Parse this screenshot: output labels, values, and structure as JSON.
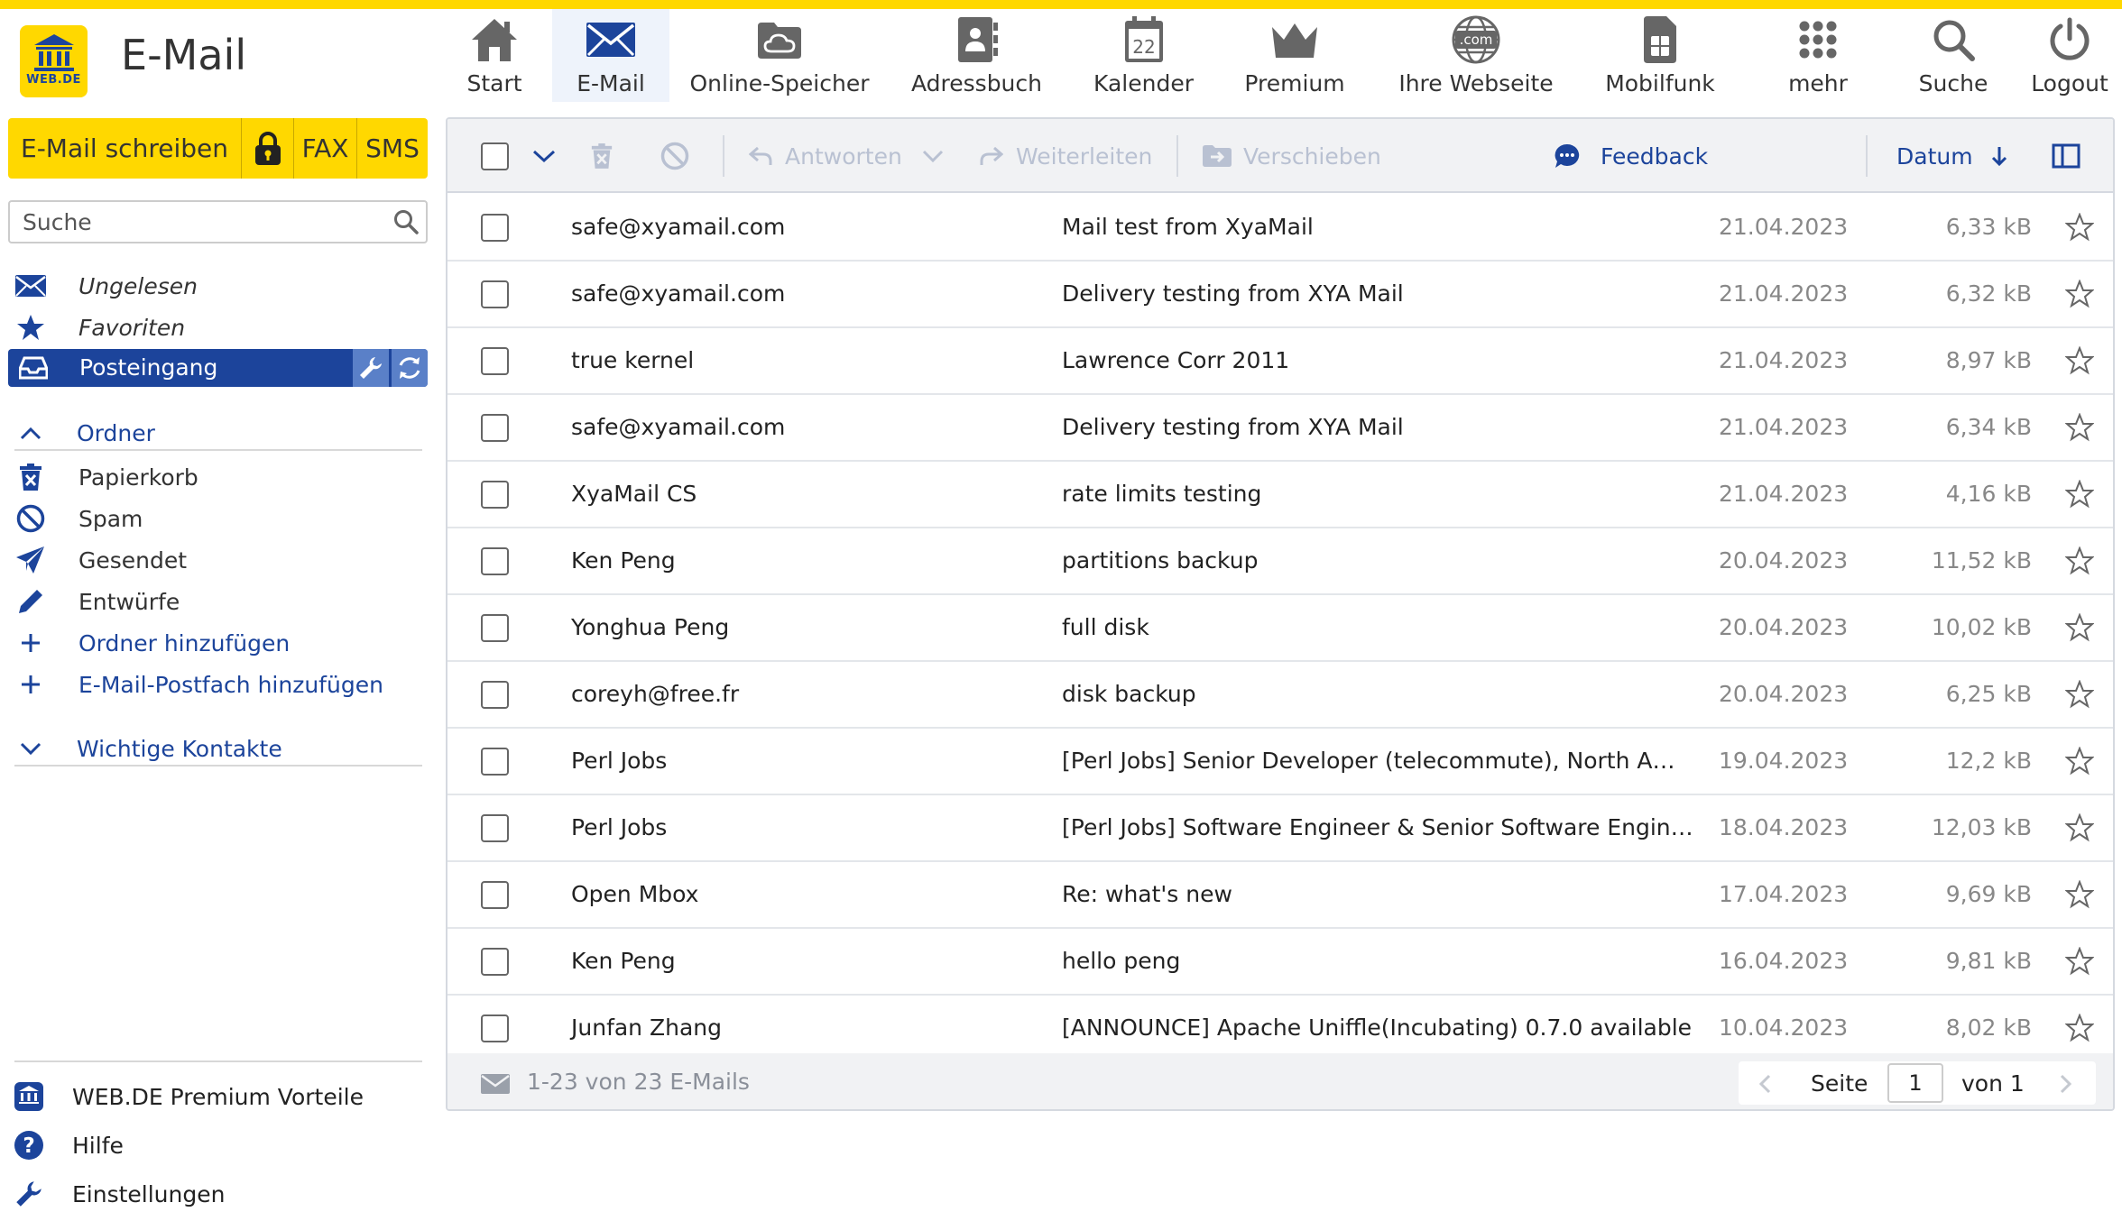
{
  "app": {
    "title": "E-Mail",
    "logo_text": "WEB.DE"
  },
  "nav": [
    {
      "label": "Start",
      "icon": "house-icon"
    },
    {
      "label": "E-Mail",
      "icon": "envelope-icon"
    },
    {
      "label": "Online-Speicher",
      "icon": "cloud-icon"
    },
    {
      "label": "Adressbuch",
      "icon": "addressbook-icon"
    },
    {
      "label": "Kalender",
      "icon": "calendar-icon",
      "badge": "22"
    },
    {
      "label": "Premium",
      "icon": "crown-icon"
    },
    {
      "label": "Ihre Webseite",
      "icon": "globe-icon",
      "badge": ".com"
    },
    {
      "label": "Mobilfunk",
      "icon": "sim-icon"
    },
    {
      "label": "mehr",
      "icon": "grid-icon"
    },
    {
      "label": "Suche",
      "icon": "search-icon"
    },
    {
      "label": "Logout",
      "icon": "power-icon"
    }
  ],
  "compose": {
    "write": "E-Mail schreiben",
    "fax": "FAX",
    "sms": "SMS"
  },
  "search": {
    "placeholder": "Suche"
  },
  "sidebar": {
    "unread": "Ungelesen",
    "favorites": "Favoriten",
    "inbox": "Posteingang",
    "folders_header": "Ordner",
    "trash": "Papierkorb",
    "spam": "Spam",
    "sent": "Gesendet",
    "drafts": "Entwürfe",
    "add_folder": "Ordner hinzufügen",
    "add_mailbox": "E-Mail-Postfach hinzufügen",
    "contacts_header": "Wichtige Kontakte",
    "premium": "WEB.DE Premium Vorteile",
    "help": "Hilfe",
    "settings": "Einstellungen"
  },
  "toolbar": {
    "reply": "Antworten",
    "forward": "Weiterleiten",
    "move": "Verschieben",
    "feedback": "Feedback",
    "sort": "Datum"
  },
  "emails": [
    {
      "from": "safe@xyamail.com",
      "subject": "Mail test from XyaMail",
      "date": "21.04.2023",
      "size": "6,33 kB"
    },
    {
      "from": "safe@xyamail.com",
      "subject": "Delivery testing from XYA Mail",
      "date": "21.04.2023",
      "size": "6,32 kB"
    },
    {
      "from": "true kernel",
      "subject": "Lawrence Corr 2011",
      "date": "21.04.2023",
      "size": "8,97 kB"
    },
    {
      "from": "safe@xyamail.com",
      "subject": "Delivery testing from XYA Mail",
      "date": "21.04.2023",
      "size": "6,34 kB"
    },
    {
      "from": "XyaMail CS",
      "subject": "rate limits testing",
      "date": "21.04.2023",
      "size": "4,16 kB"
    },
    {
      "from": "Ken Peng",
      "subject": "partitions backup",
      "date": "20.04.2023",
      "size": "11,52 kB"
    },
    {
      "from": "Yonghua Peng",
      "subject": "full disk",
      "date": "20.04.2023",
      "size": "10,02 kB"
    },
    {
      "from": "coreyh@free.fr",
      "subject": "disk backup",
      "date": "20.04.2023",
      "size": "6,25 kB"
    },
    {
      "from": "Perl Jobs",
      "subject": "[Perl Jobs] Senior Developer (telecommute), North America",
      "date": "19.04.2023",
      "size": "12,2 kB"
    },
    {
      "from": "Perl Jobs",
      "subject": "[Perl Jobs] Software Engineer & Senior Software Engineer",
      "date": "18.04.2023",
      "size": "12,03 kB"
    },
    {
      "from": "Open Mbox",
      "subject": "Re: what's new",
      "date": "17.04.2023",
      "size": "9,69 kB"
    },
    {
      "from": "Ken Peng",
      "subject": "hello peng",
      "date": "16.04.2023",
      "size": "9,81 kB"
    },
    {
      "from": "Junfan Zhang",
      "subject": "[ANNOUNCE] Apache Uniffle(Incubating) 0.7.0 available",
      "date": "10.04.2023",
      "size": "8,02 kB"
    }
  ],
  "footer": {
    "count": "1-23 von 23 E-Mails",
    "page_label": "Seite",
    "page_value": "1",
    "of_label": "von 1"
  },
  "colors": {
    "brand_yellow": "#ffd800",
    "brand_blue": "#1c449b"
  }
}
